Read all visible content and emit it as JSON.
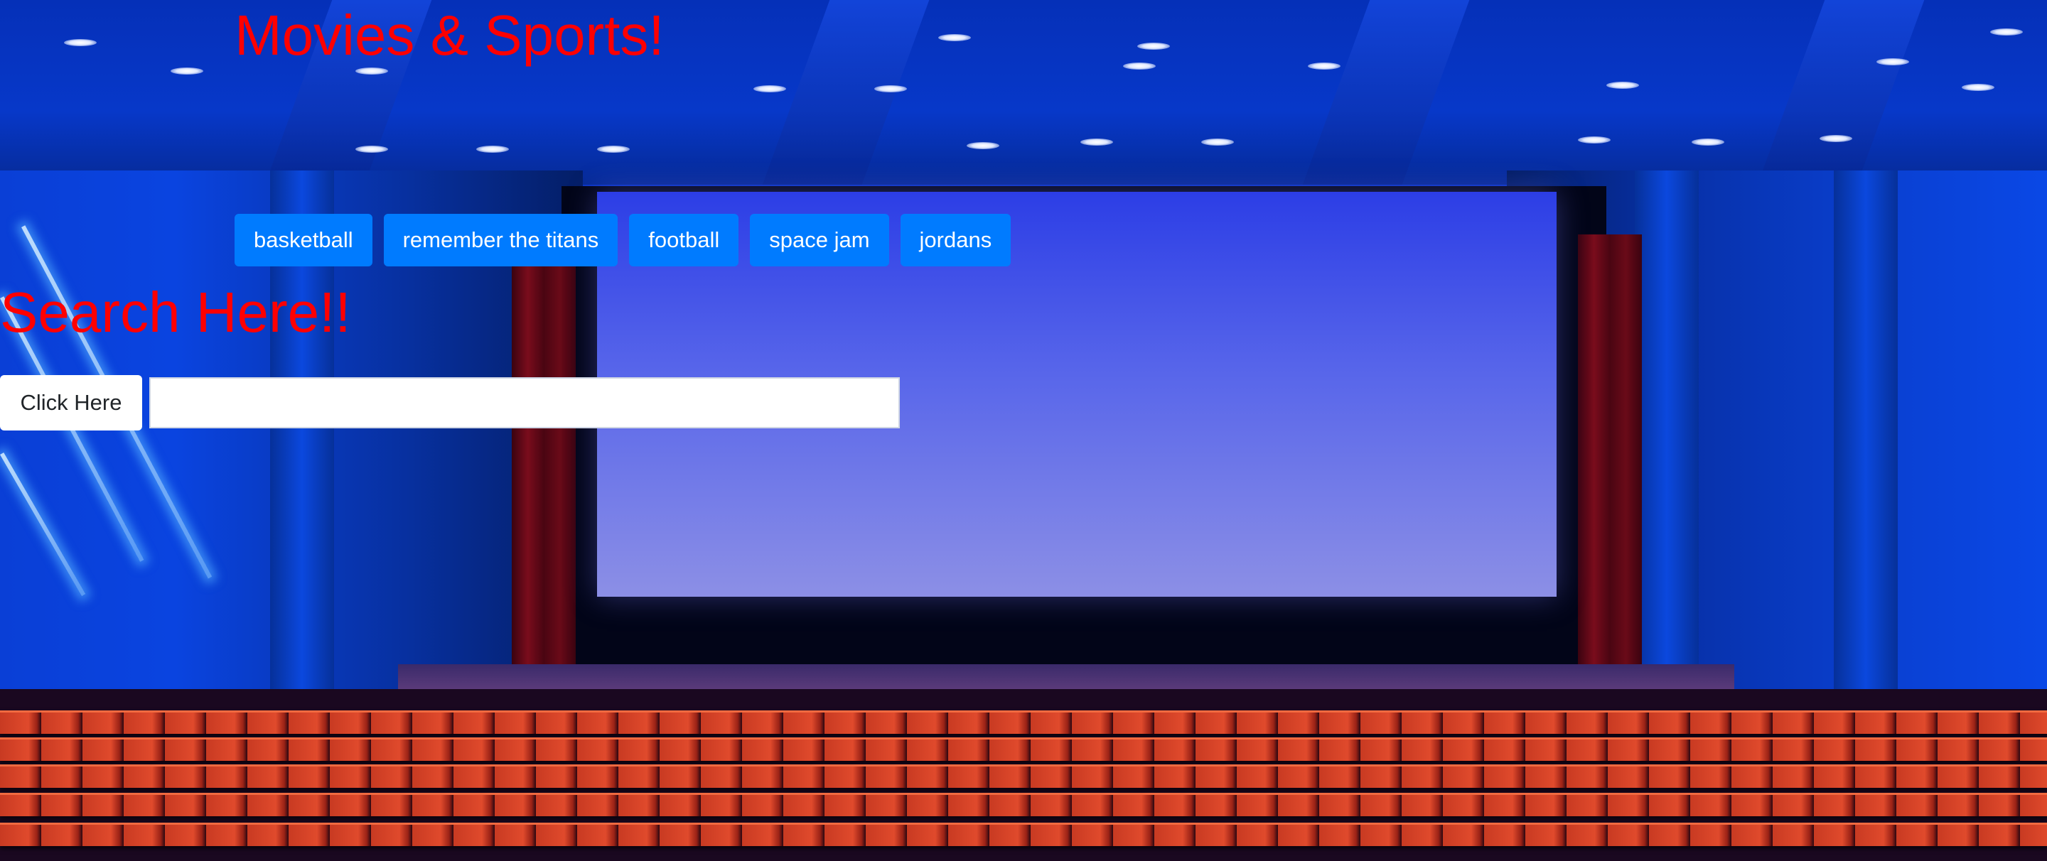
{
  "page": {
    "title": "Movies & Sports!"
  },
  "topics": {
    "buttons": [
      {
        "label": "basketball"
      },
      {
        "label": "remember the titans"
      },
      {
        "label": "football"
      },
      {
        "label": "space jam"
      },
      {
        "label": "jordans"
      }
    ]
  },
  "search": {
    "heading": "Search Here!!",
    "button_label": "Click Here",
    "input_value": "",
    "input_placeholder": ""
  },
  "background": {
    "description_icon": "movie-theater-background-image"
  },
  "colors": {
    "title_text": "#ff0000",
    "chip_bg": "#007bff",
    "chip_text": "#ffffff",
    "button_bg": "#ffffff",
    "button_text": "#212529"
  }
}
